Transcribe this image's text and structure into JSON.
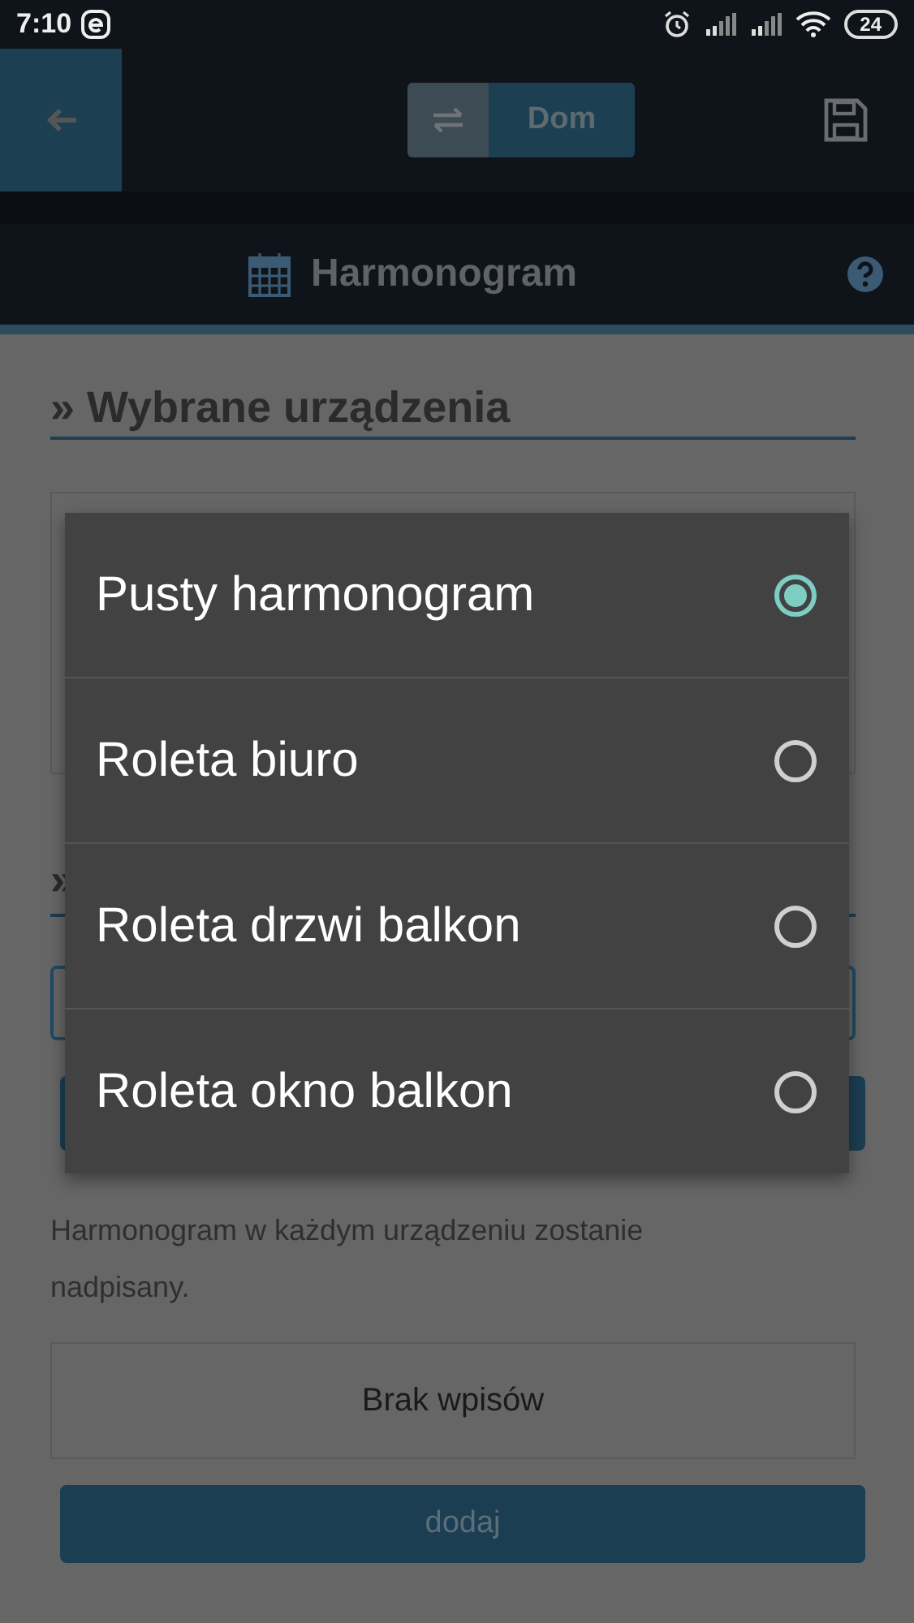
{
  "status_bar": {
    "time": "7:10",
    "battery": "24"
  },
  "header": {
    "toggle": {
      "label": "Dom"
    }
  },
  "title_bar": {
    "title": "Harmonogram"
  },
  "section": {
    "heading": "» Wybrane urządzenia"
  },
  "section_2": {
    "heading": "»"
  },
  "note": "Harmonogram w każdym urządzeniu zostanie nadpisany.",
  "entries": {
    "empty_text": "Brak wpisów"
  },
  "add_button": {
    "label": "dodaj"
  },
  "dialog": {
    "options": [
      {
        "label": "Pusty harmonogram",
        "selected": true
      },
      {
        "label": "Roleta biuro",
        "selected": false
      },
      {
        "label": "Roleta drzwi balkon",
        "selected": false
      },
      {
        "label": "Roleta okno balkon",
        "selected": false
      }
    ]
  }
}
